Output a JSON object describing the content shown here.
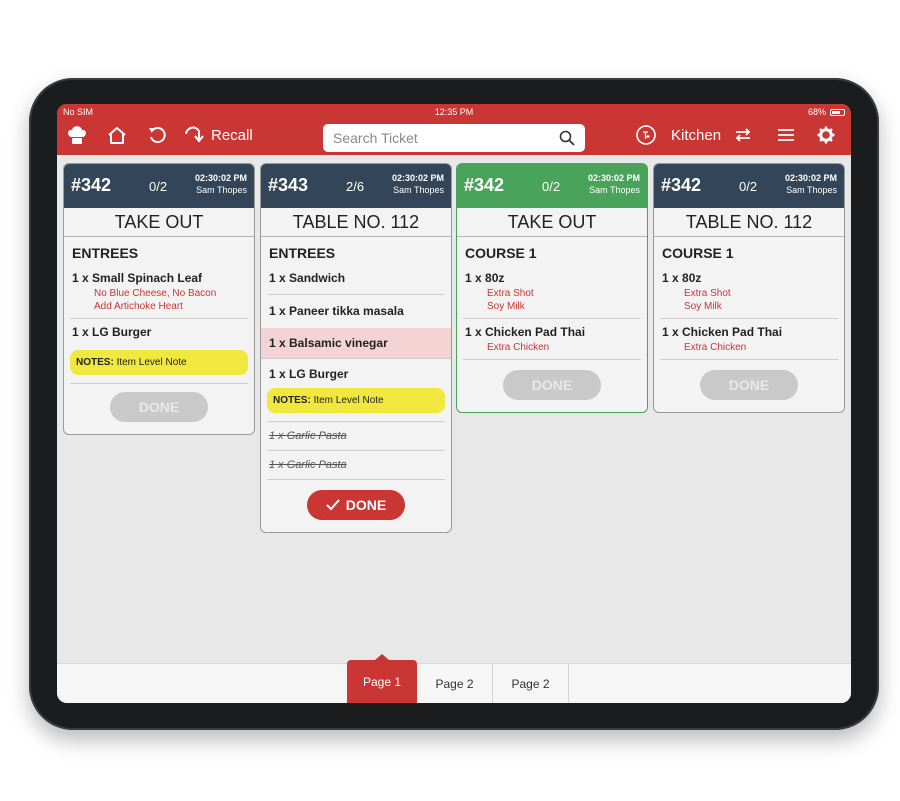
{
  "status": {
    "carrier": "No SIM",
    "time": "12:35 PM",
    "battery": "68%"
  },
  "header": {
    "recall_label": "Recall",
    "search_placeholder": "Search Ticket",
    "station_label": "Kitchen"
  },
  "tickets": [
    {
      "number": "#342",
      "count": "0/2",
      "time": "02:30:02 PM",
      "server": "Sam Thopes",
      "title": "TAKE OUT",
      "section": "ENTREES",
      "items": [
        {
          "text": "1 x Small Spinach Leaf",
          "mods": [
            "No Blue Cheese, No Bacon",
            "Add Artichoke Heart"
          ]
        },
        {
          "text": "1 x LG Burger"
        }
      ],
      "note_label": "NOTES:",
      "note_text": "Item Level Note",
      "done_label": "DONE"
    },
    {
      "number": "#343",
      "count": "2/6",
      "time": "02:30:02 PM",
      "server": "Sam Thopes",
      "title": "TABLE NO. 112",
      "section": "ENTREES",
      "items": [
        {
          "text": "1 x Sandwich"
        },
        {
          "text": "1 x Paneer tikka masala"
        },
        {
          "text": "1 x Balsamic vinegar"
        },
        {
          "text": "1 x LG Burger"
        }
      ],
      "note_label": "NOTES:",
      "note_text": "Item Level Note",
      "struck": [
        "1 x Garlic Pasta",
        "1 x Garlic Pasta"
      ],
      "done_label": "DONE"
    },
    {
      "number": "#342",
      "count": "0/2",
      "time": "02:30:02 PM",
      "server": "Sam Thopes",
      "title": "TAKE OUT",
      "section": "COURSE 1",
      "items": [
        {
          "text": "1 x 80z",
          "mods": [
            "Extra Shot",
            "Soy Milk"
          ]
        },
        {
          "text": "1 x Chicken Pad Thai",
          "mods": [
            "Extra Chicken"
          ]
        }
      ],
      "done_label": "DONE"
    },
    {
      "number": "#342",
      "count": "0/2",
      "time": "02:30:02 PM",
      "server": "Sam Thopes",
      "title": "TABLE NO. 112",
      "section": "COURSE 1",
      "items": [
        {
          "text": "1 x 80z",
          "mods": [
            "Extra Shot",
            "Soy Milk"
          ]
        },
        {
          "text": "1 x Chicken Pad Thai",
          "mods": [
            "Extra Chicken"
          ]
        }
      ],
      "done_label": "DONE"
    }
  ],
  "pages": [
    "Page 1",
    "Page 2",
    "Page 2"
  ],
  "colors": {
    "brand_red": "#c93634",
    "ticket_header": "#334558",
    "ticket_green": "#4aa35a",
    "note_yellow": "#f1e83f"
  }
}
